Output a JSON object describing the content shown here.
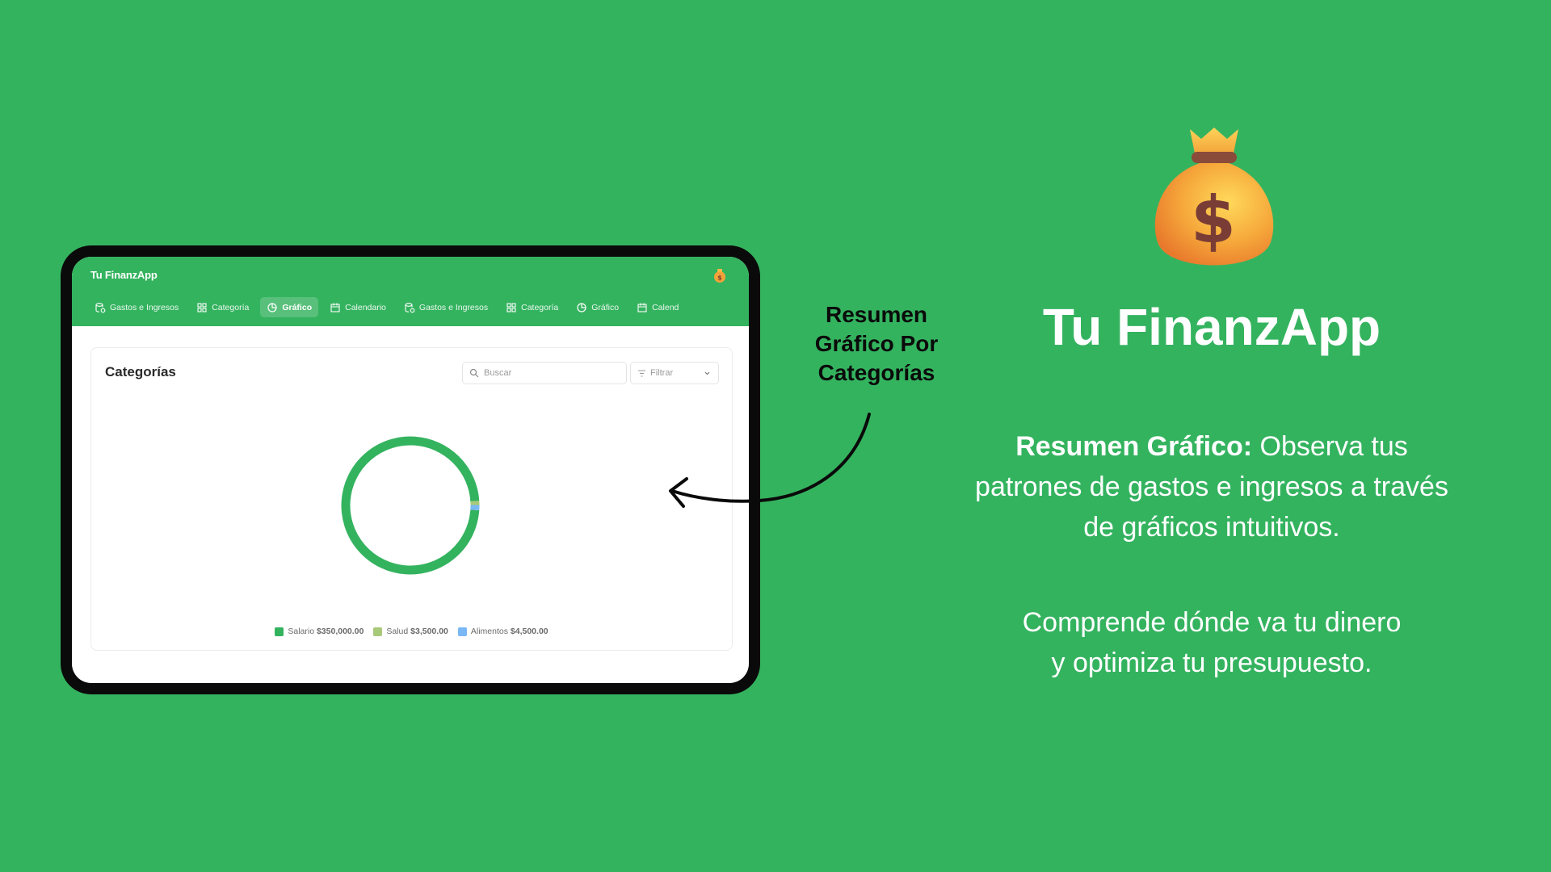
{
  "app": {
    "title": "Tu FinanzApp",
    "nav": [
      {
        "label": "Gastos e Ingresos",
        "icon": "database-icon"
      },
      {
        "label": "Categoría",
        "icon": "grid-icon"
      },
      {
        "label": "Gráfico",
        "icon": "pie-chart-icon",
        "active": true
      },
      {
        "label": "Calendario",
        "icon": "calendar-icon"
      },
      {
        "label": "Gastos e Ingresos",
        "icon": "database-icon"
      },
      {
        "label": "Categoría",
        "icon": "grid-icon"
      },
      {
        "label": "Gráfico",
        "icon": "pie-chart-icon"
      },
      {
        "label": "Calend",
        "icon": "calendar-icon"
      }
    ],
    "card": {
      "title": "Categorías",
      "search_placeholder": "Buscar",
      "filter_label": "Filtrar"
    }
  },
  "chart_data": {
    "type": "pie",
    "donut": true,
    "labels": [
      "Salario",
      "Salud",
      "Alimentos"
    ],
    "values": [
      350000,
      3500,
      4500
    ],
    "value_labels": [
      "$350,000.00",
      "$3,500.00",
      "$4,500.00"
    ],
    "colors": [
      "#34b35f",
      "#a8c97a",
      "#7ab8f5"
    ]
  },
  "callout": {
    "line1": "Resumen",
    "line2": "Gráfico Por",
    "line3": "Categorías"
  },
  "brand": {
    "title": "Tu FinanzApp",
    "desc_bold": "Resumen Gráfico:",
    "desc_line1": " Observa tus",
    "desc_line2": "patrones de gastos e ingresos a través",
    "desc_line3": "de gráficos intuitivos.",
    "tagline_line1": "Comprende dónde va tu dinero",
    "tagline_line2": "y optimiza tu presupuesto."
  },
  "colors": {
    "background": "#34b35f",
    "accent": "#34b35f",
    "device_frame": "#0a0a0a"
  }
}
